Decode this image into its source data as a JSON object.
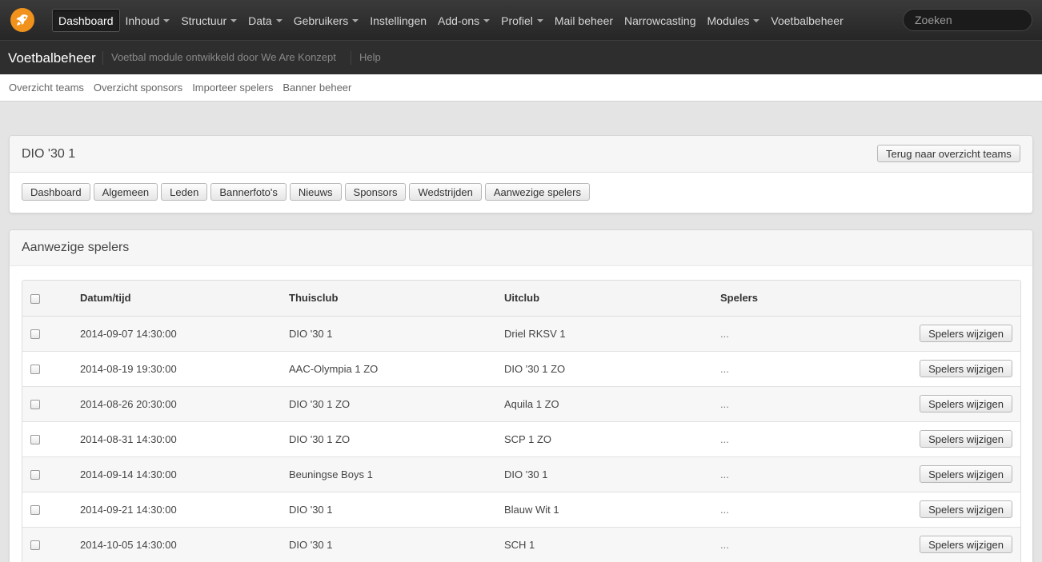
{
  "topnav": {
    "logo_icon": "rocket-icon",
    "items": [
      {
        "label": "Dashboard",
        "dropdown": false
      },
      {
        "label": "Inhoud",
        "dropdown": true
      },
      {
        "label": "Structuur",
        "dropdown": true
      },
      {
        "label": "Data",
        "dropdown": true
      },
      {
        "label": "Gebruikers",
        "dropdown": true
      },
      {
        "label": "Instellingen",
        "dropdown": false
      },
      {
        "label": "Add-ons",
        "dropdown": true
      },
      {
        "label": "Profiel",
        "dropdown": true
      },
      {
        "label": "Mail beheer",
        "dropdown": false
      },
      {
        "label": "Narrowcasting",
        "dropdown": false
      },
      {
        "label": "Modules",
        "dropdown": true
      },
      {
        "label": "Voetbalbeheer",
        "dropdown": false
      }
    ],
    "search_placeholder": "Zoeken"
  },
  "module": {
    "title": "Voetbalbeheer",
    "subtitle": "Voetbal module ontwikkeld door We Are Konzept",
    "help": "Help"
  },
  "subnav": [
    "Overzicht teams",
    "Overzicht sponsors",
    "Importeer spelers",
    "Banner beheer"
  ],
  "team_panel": {
    "title": "DIO '30 1",
    "back_button": "Terug naar overzicht teams",
    "tabs": [
      "Dashboard",
      "Algemeen",
      "Leden",
      "Bannerfoto's",
      "Nieuws",
      "Sponsors",
      "Wedstrijden",
      "Aanwezige spelers"
    ]
  },
  "players_panel": {
    "title": "Aanwezige spelers",
    "columns": [
      "Datum/tijd",
      "Thuisclub",
      "Uitclub",
      "Spelers"
    ],
    "action_label": "Spelers wijzigen",
    "rows": [
      {
        "datetime": "2014-09-07 14:30:00",
        "home": "DIO '30 1",
        "away": "Driel RKSV 1",
        "players": "..."
      },
      {
        "datetime": "2014-08-19 19:30:00",
        "home": "AAC-Olympia 1 ZO",
        "away": "DIO '30 1 ZO",
        "players": "..."
      },
      {
        "datetime": "2014-08-26 20:30:00",
        "home": "DIO '30 1 ZO",
        "away": "Aquila 1 ZO",
        "players": "..."
      },
      {
        "datetime": "2014-08-31 14:30:00",
        "home": "DIO '30 1 ZO",
        "away": "SCP 1 ZO",
        "players": "..."
      },
      {
        "datetime": "2014-09-14 14:30:00",
        "home": "Beuningse Boys 1",
        "away": "DIO '30 1",
        "players": "..."
      },
      {
        "datetime": "2014-09-21 14:30:00",
        "home": "DIO '30 1",
        "away": "Blauw Wit 1",
        "players": "..."
      },
      {
        "datetime": "2014-10-05 14:30:00",
        "home": "DIO '30 1",
        "away": "SCH 1",
        "players": "..."
      }
    ]
  },
  "colors": {
    "accent": "#f0921c",
    "topbar": "#2e2e2e"
  }
}
